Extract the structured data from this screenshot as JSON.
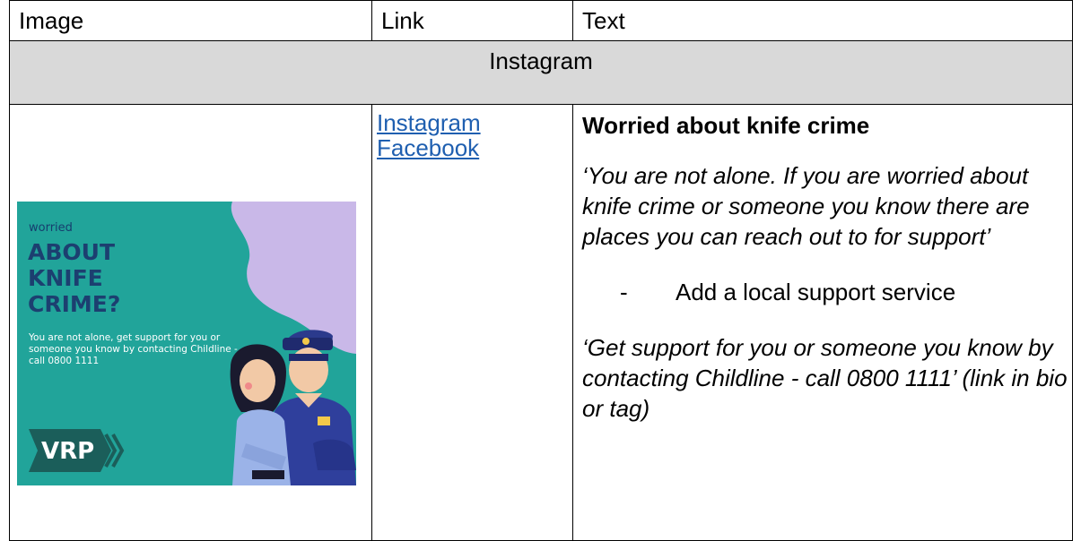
{
  "table": {
    "headers": [
      "Image",
      "Link",
      "Text"
    ],
    "section_title": "Instagram",
    "links": [
      "Instagram",
      "Facebook"
    ],
    "text": {
      "title": "Worried about knife crime",
      "quote1": "‘You are not alone. If you are worried about knife crime or someone you know there are places you can reach out to for support’",
      "bullet_dash": "-",
      "bullet": "Add a local support service",
      "quote2": "‘Get support for you or someone you know by contacting Childline - call 0800 1111’ (link in bio or tag)"
    }
  },
  "poster": {
    "small_heading": "worried",
    "headline": [
      "ABOUT",
      "KNIFE",
      "CRIME?"
    ],
    "body": "You are not alone, get support for you or someone you know by contacting Childline - call 0800 1111",
    "logo_text": "VRP",
    "colors": {
      "background": "#21a49a",
      "blob": "#c9b8e8",
      "headline": "#1c3f70",
      "body_text": "#ffffff"
    }
  }
}
